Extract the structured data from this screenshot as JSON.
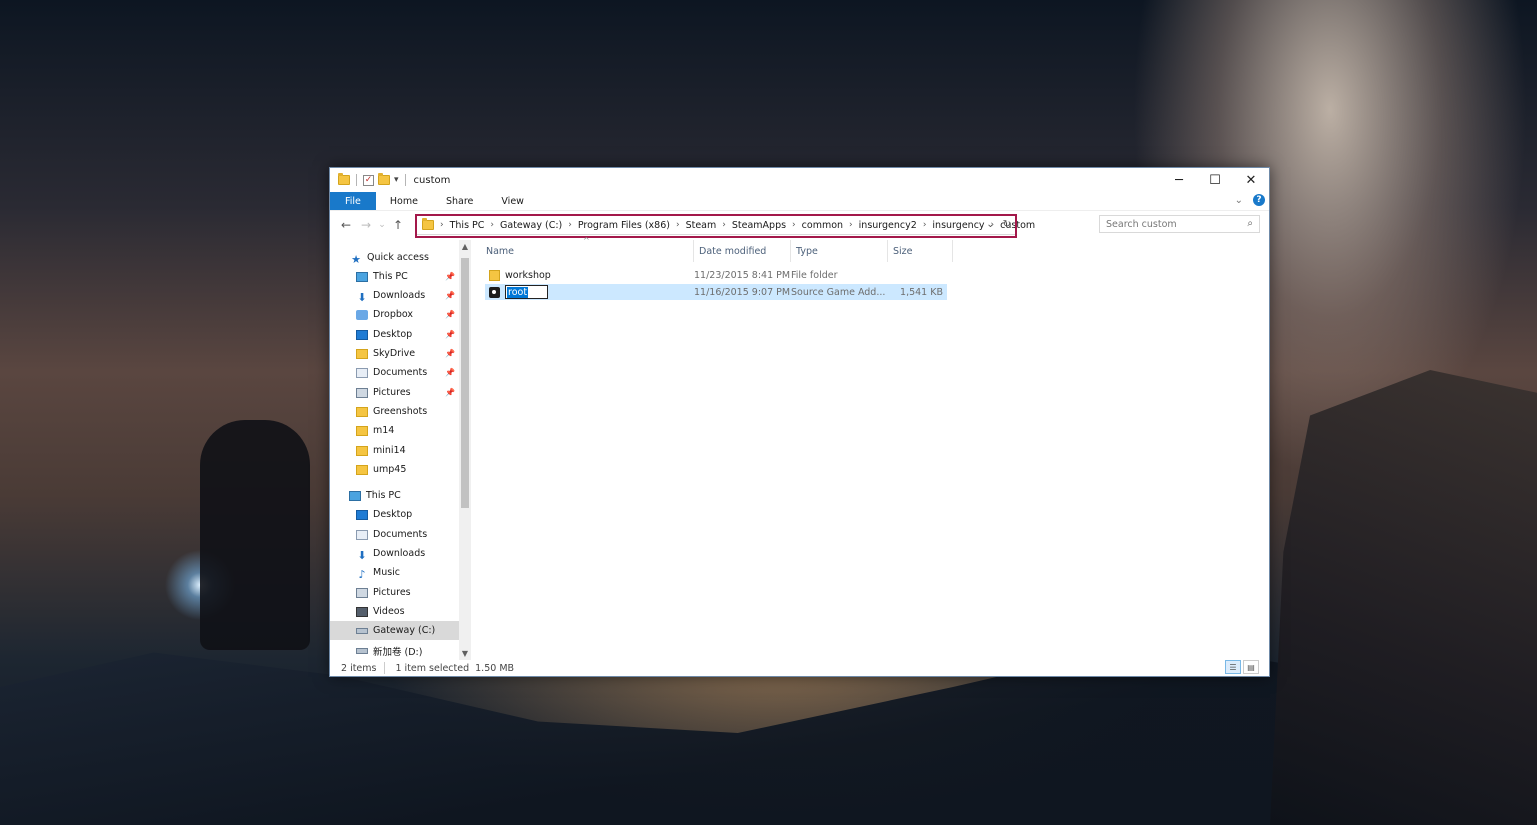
{
  "window": {
    "title": "custom",
    "controls": {
      "minimize": "─",
      "maximize": "☐",
      "close": "✕"
    }
  },
  "ribbon": {
    "tabs": [
      "File",
      "Home",
      "Share",
      "View"
    ],
    "help": "?"
  },
  "address_bar": {
    "crumbs": [
      "This PC",
      "Gateway (C:)",
      "Program Files (x86)",
      "Steam",
      "SteamApps",
      "common",
      "insurgency2",
      "insurgency",
      "custom"
    ]
  },
  "search": {
    "placeholder": "Search custom"
  },
  "nav_pane": {
    "quick_access": {
      "label": "Quick access",
      "items": [
        "This PC",
        "Downloads",
        "Dropbox",
        "Desktop",
        "SkyDrive",
        "Documents",
        "Pictures",
        "Greenshots",
        "m14",
        "mini14",
        "ump45"
      ]
    },
    "this_pc": {
      "label": "This PC",
      "items": [
        "Desktop",
        "Documents",
        "Downloads",
        "Music",
        "Pictures",
        "Videos",
        "Gateway (C:)",
        "新加卷 (D:)"
      ]
    }
  },
  "columns": [
    "Name",
    "Date modified",
    "Type",
    "Size"
  ],
  "files": [
    {
      "name": "workshop",
      "date": "11/23/2015 8:41 PM",
      "type": "File folder",
      "size": "",
      "icon": "folder-icon"
    },
    {
      "name": "root",
      "date": "11/16/2015 9:07 PM",
      "type": "Source Game Add...",
      "size": "1,541 KB",
      "icon": "steam-icon"
    }
  ],
  "status": {
    "count": "2 items",
    "selected": "1 item selected",
    "size": "1.50 MB"
  },
  "colors": {
    "accent": "#1979ca",
    "highlight_border": "#a3184a",
    "selection": "#cce8ff"
  }
}
